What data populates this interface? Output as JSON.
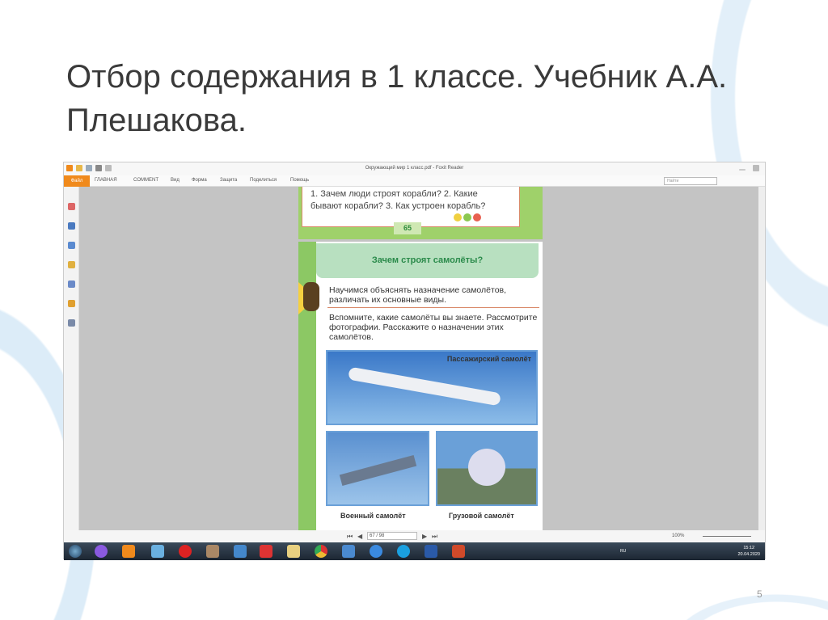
{
  "slide": {
    "title": "Отбор содержания в  1 классе. Учебник А.А. Плешакова.",
    "page_number": "5"
  },
  "app": {
    "window_title": "Окружающий мир 1 класс.pdf - Foxit Reader",
    "tabs": [
      "Файл",
      "ГЛАВНАЯ",
      "COMMENT",
      "Вид",
      "Форма",
      "Защита",
      "Поделиться",
      "Помощь"
    ],
    "search_placeholder": "Найти",
    "page_field": "67 / 98",
    "zoom": "100%"
  },
  "document": {
    "prev_page_text": "1. Зачем люди строят корабли? 2. Какие бывают корабли? 3. Как устроен корабль?",
    "prev_page_number": "65",
    "heading": "Зачем строят самолёты?",
    "goal": "Научимся объяснять назначение самолётов, различать их основные виды.",
    "task": "Вспомните, какие самолёты вы знаете. Рассмотрите фотографии. Расскажите о назначении этих самолётов.",
    "captions": [
      "Пассажирский самолёт",
      "Военный самолёт",
      "Грузовой самолёт"
    ]
  },
  "taskbar": {
    "language": "RU",
    "time": "15:12",
    "date": "20.04.2020"
  }
}
